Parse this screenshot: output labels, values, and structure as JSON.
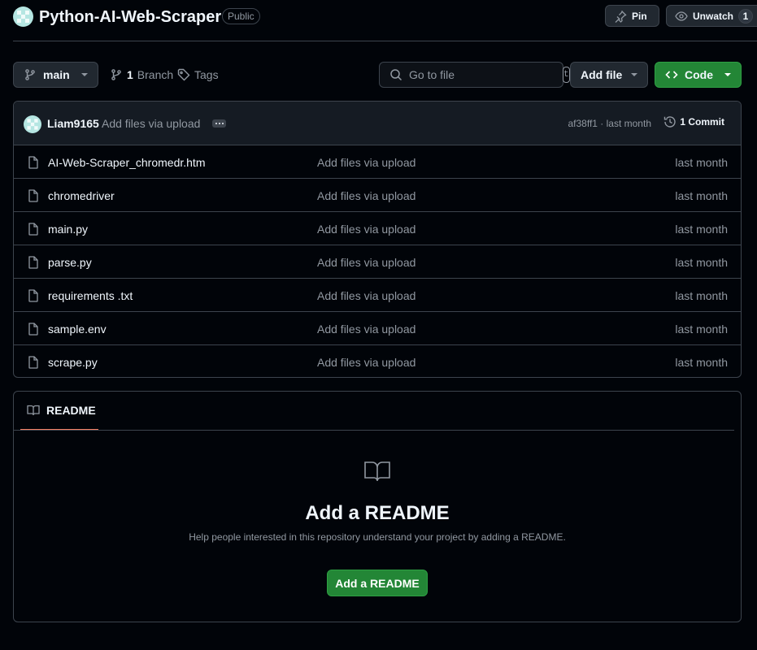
{
  "header": {
    "repo_name": "Python-AI-Web-Scraper",
    "visibility_badge": "Public",
    "pin_label": "Pin",
    "watch_label": "Unwatch",
    "watch_count": "1"
  },
  "toolbar": {
    "branch_name": "main",
    "branch_count": "1",
    "branch_label": "Branch",
    "tags_label": "Tags",
    "search_placeholder": "Go to file",
    "search_shortcut": "t",
    "add_file_label": "Add file",
    "code_label": "Code"
  },
  "latest_commit": {
    "author": "Liam9165",
    "message": "Add files via upload",
    "hash_time": "af38ff1 · last month",
    "commit_count_label": "1 Commit"
  },
  "files": [
    {
      "name": "AI-Web-Scraper_chromedr.htm",
      "message": "Add files via upload",
      "time": "last month"
    },
    {
      "name": "chromedriver",
      "message": "Add files via upload",
      "time": "last month"
    },
    {
      "name": "main.py",
      "message": "Add files via upload",
      "time": "last month"
    },
    {
      "name": "parse.py",
      "message": "Add files via upload",
      "time": "last month"
    },
    {
      "name": "requirements .txt",
      "message": "Add files via upload",
      "time": "last month"
    },
    {
      "name": "sample.env",
      "message": "Add files via upload",
      "time": "last month"
    },
    {
      "name": "scrape.py",
      "message": "Add files via upload",
      "time": "last month"
    }
  ],
  "readme": {
    "tab_label": "README",
    "heading": "Add a README",
    "description": "Help people interested in this repository understand your project by adding a README.",
    "button_label": "Add a README"
  },
  "colors": {
    "background": "#010409",
    "border": "#3d444d",
    "primary_button": "#238636",
    "tab_underline": "#f78166",
    "muted_text": "#9198a1"
  },
  "icons": [
    "identicon-avatar",
    "pin-icon",
    "eye-icon",
    "git-branch-icon",
    "tag-icon",
    "search-icon",
    "code-icon",
    "history-icon",
    "file-icon",
    "book-icon"
  ]
}
